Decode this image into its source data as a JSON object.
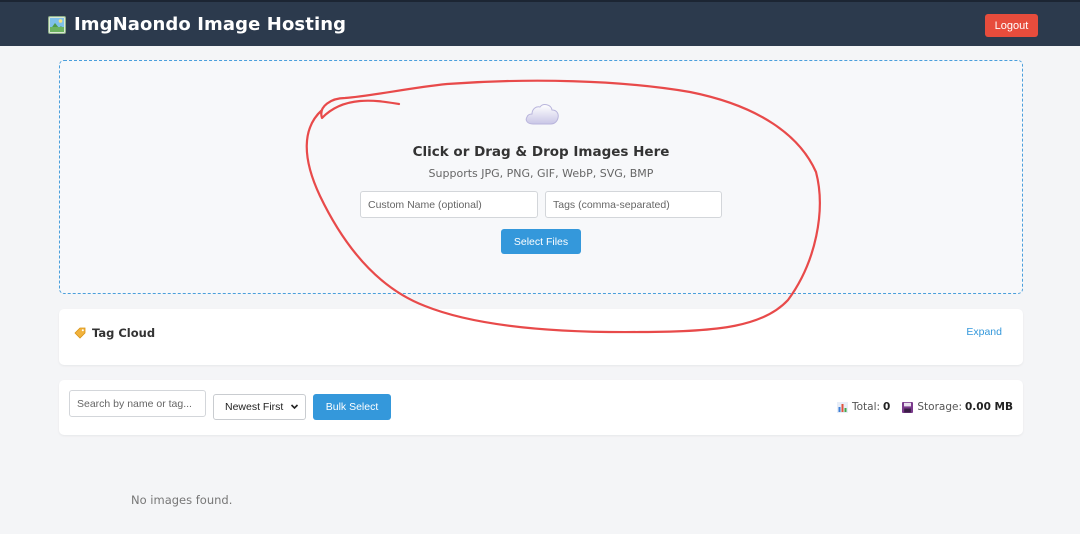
{
  "header": {
    "title": "ImgNaondo Image Hosting",
    "brand_icon": "picture-icon",
    "logout_label": "Logout",
    "colors": {
      "bar": "#2c3a4d",
      "logout": "#e74c3c"
    }
  },
  "upload": {
    "icon": "cloud-icon",
    "title": "Click or Drag & Drop Images Here",
    "subtitle": "Supports JPG, PNG, GIF, WebP, SVG, BMP",
    "custom_name_placeholder": "Custom Name (optional)",
    "tags_placeholder": "Tags (comma-separated)",
    "select_files_label": "Select Files",
    "accent": "#3498db"
  },
  "tag_cloud": {
    "icon": "tag-icon",
    "title": "Tag Cloud",
    "expand_label": "Expand"
  },
  "toolbar": {
    "search_placeholder": "Search by name or tag...",
    "sort_selected": "Newest First",
    "bulk_select_label": "Bulk Select",
    "total_label": "Total:",
    "total_value": "0",
    "storage_label": "Storage:",
    "storage_value": "0.00 MB"
  },
  "gallery": {
    "empty_message": "No images found."
  },
  "annotation": {
    "type": "hand-drawn red circle around upload area",
    "color": "#e84a4a"
  }
}
